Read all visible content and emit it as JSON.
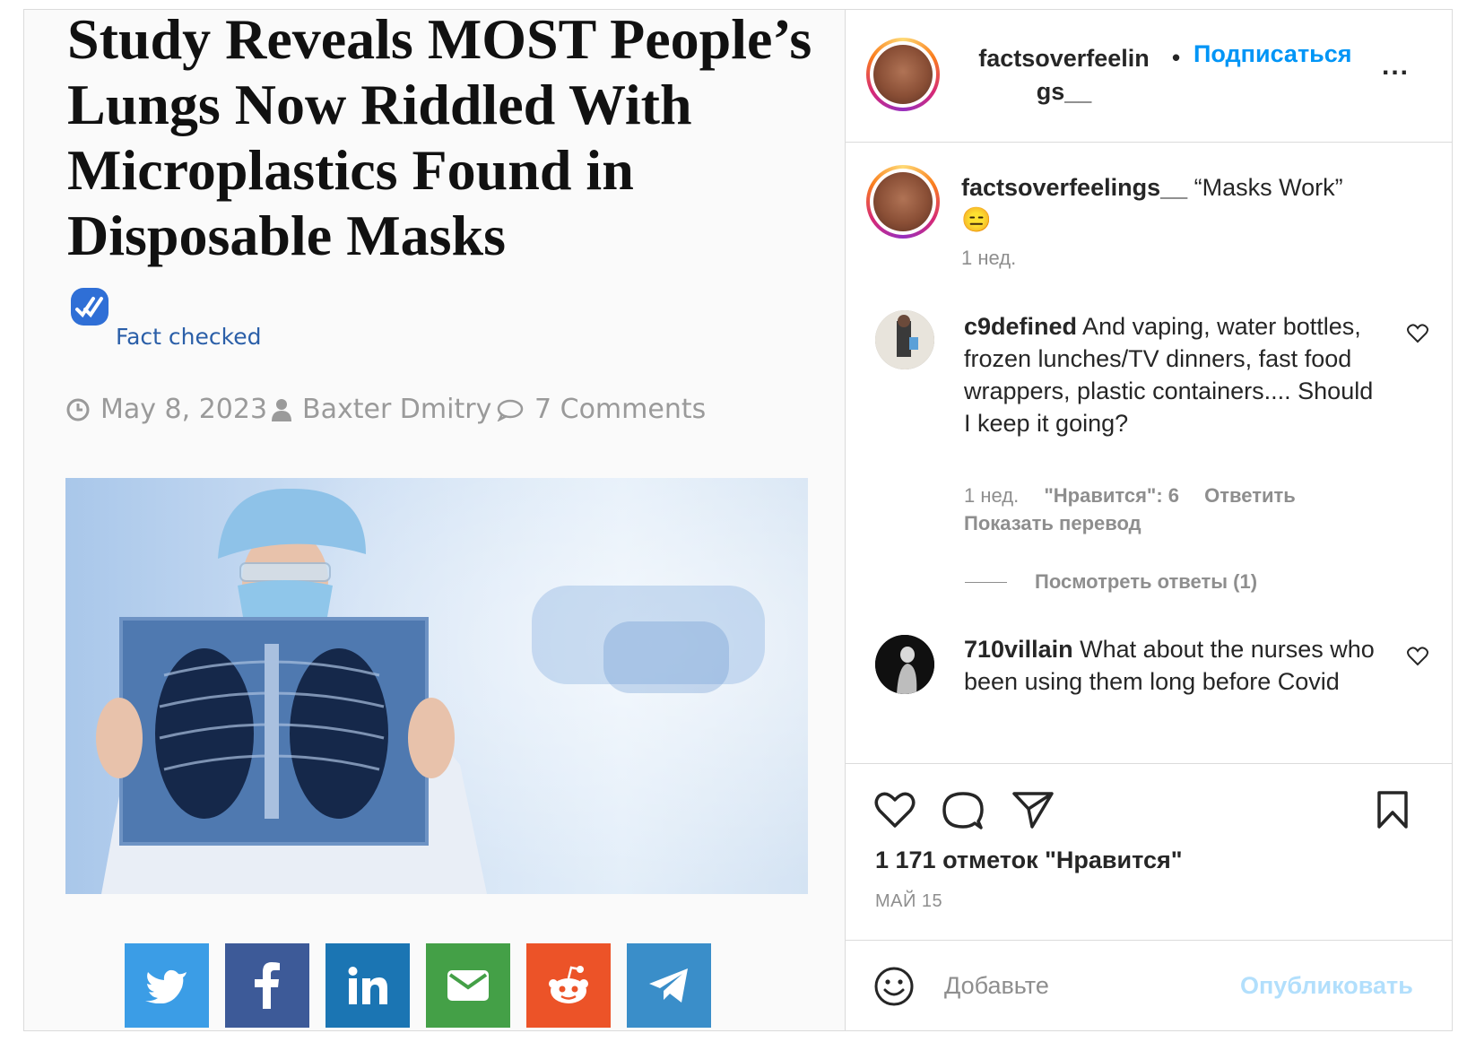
{
  "article": {
    "headline": "Study Reveals MOST People’s Lungs Now Riddled With Microplastics Found in Disposable Masks",
    "fact_checked": "Fact checked",
    "date": "May 8, 2023",
    "author": "Baxter Dmitry",
    "comments": "7 Comments",
    "share_buttons": [
      {
        "network": "twitter",
        "icon": "twitter-bird-icon",
        "color": "#3b9de6"
      },
      {
        "network": "facebook",
        "icon": "facebook-f-icon",
        "color": "#3d5a98"
      },
      {
        "network": "linkedin",
        "icon": "linkedin-in-icon",
        "color": "#1b75b3"
      },
      {
        "network": "email",
        "icon": "envelope-icon",
        "color": "#44a047"
      },
      {
        "network": "reddit",
        "icon": "reddit-alien-icon",
        "color": "#ec5328"
      },
      {
        "network": "telegram",
        "icon": "paper-plane-icon",
        "color": "#3a8ec9"
      }
    ]
  },
  "post": {
    "username_line1": "factsoverfeelin",
    "username_line2": "gs__",
    "separator": "•",
    "follow_label": "Подписаться",
    "more_label": "...",
    "caption_user": "factsoverfeelings__",
    "caption_text": " “Masks Work”",
    "caption_emoji": "😑",
    "caption_time": "1 нед."
  },
  "comments": [
    {
      "user": "c9defined",
      "text": " And vaping, water bottles, frozen lunches/TV dinners, fast food wrappers, plastic containers.... Should I keep it going?",
      "time": "1 нед.",
      "likes": "\"Нравится\": 6",
      "reply": "Ответить",
      "translate": "Показать перевод",
      "view_replies": "Посмотреть ответы (1)"
    },
    {
      "user": "710villain",
      "text": " What about the nurses who been using them long before Covid"
    }
  ],
  "stats": {
    "likes": "1 171 отметок \"Нравится\"",
    "date": "МАЙ 15"
  },
  "add_comment": {
    "placeholder": "Добавьте",
    "publish": "Опубликовать"
  },
  "colors": {
    "link_blue": "#0095f6",
    "publish_disabled": "#b2dffc",
    "muted": "#8e8e8e"
  }
}
